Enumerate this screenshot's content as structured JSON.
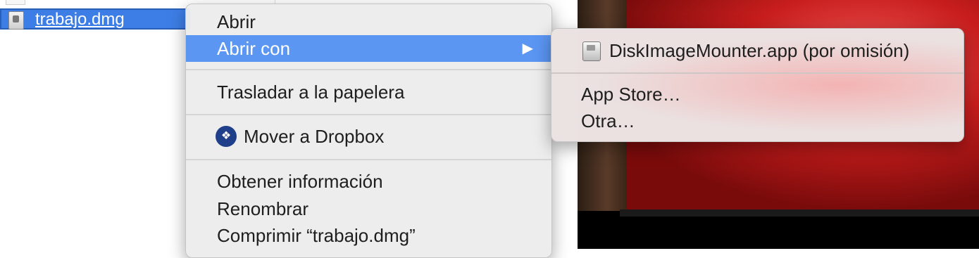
{
  "finder": {
    "selected_file": {
      "name": "trabajo.dmg",
      "icon": "dmg-file-icon"
    },
    "accent_color": "#3d7ee6"
  },
  "context_menu": {
    "items": [
      {
        "label": "Abrir"
      },
      {
        "label": "Abrir con",
        "has_submenu": true,
        "highlighted": true
      },
      {
        "label": "Trasladar a la papelera"
      },
      {
        "label": "Mover a Dropbox",
        "icon": "dropbox-icon"
      },
      {
        "label": "Obtener información"
      },
      {
        "label": "Renombrar"
      },
      {
        "label": "Comprimir “trabajo.dmg”"
      }
    ],
    "highlight_color": "#5b96f3",
    "submenu_arrow": "▶"
  },
  "submenu": {
    "items": [
      {
        "label": "DiskImageMounter.app (por omisión)",
        "icon": "disk-image-mounter-icon"
      },
      {
        "label": "App Store…"
      },
      {
        "label": "Otra…"
      }
    ]
  }
}
